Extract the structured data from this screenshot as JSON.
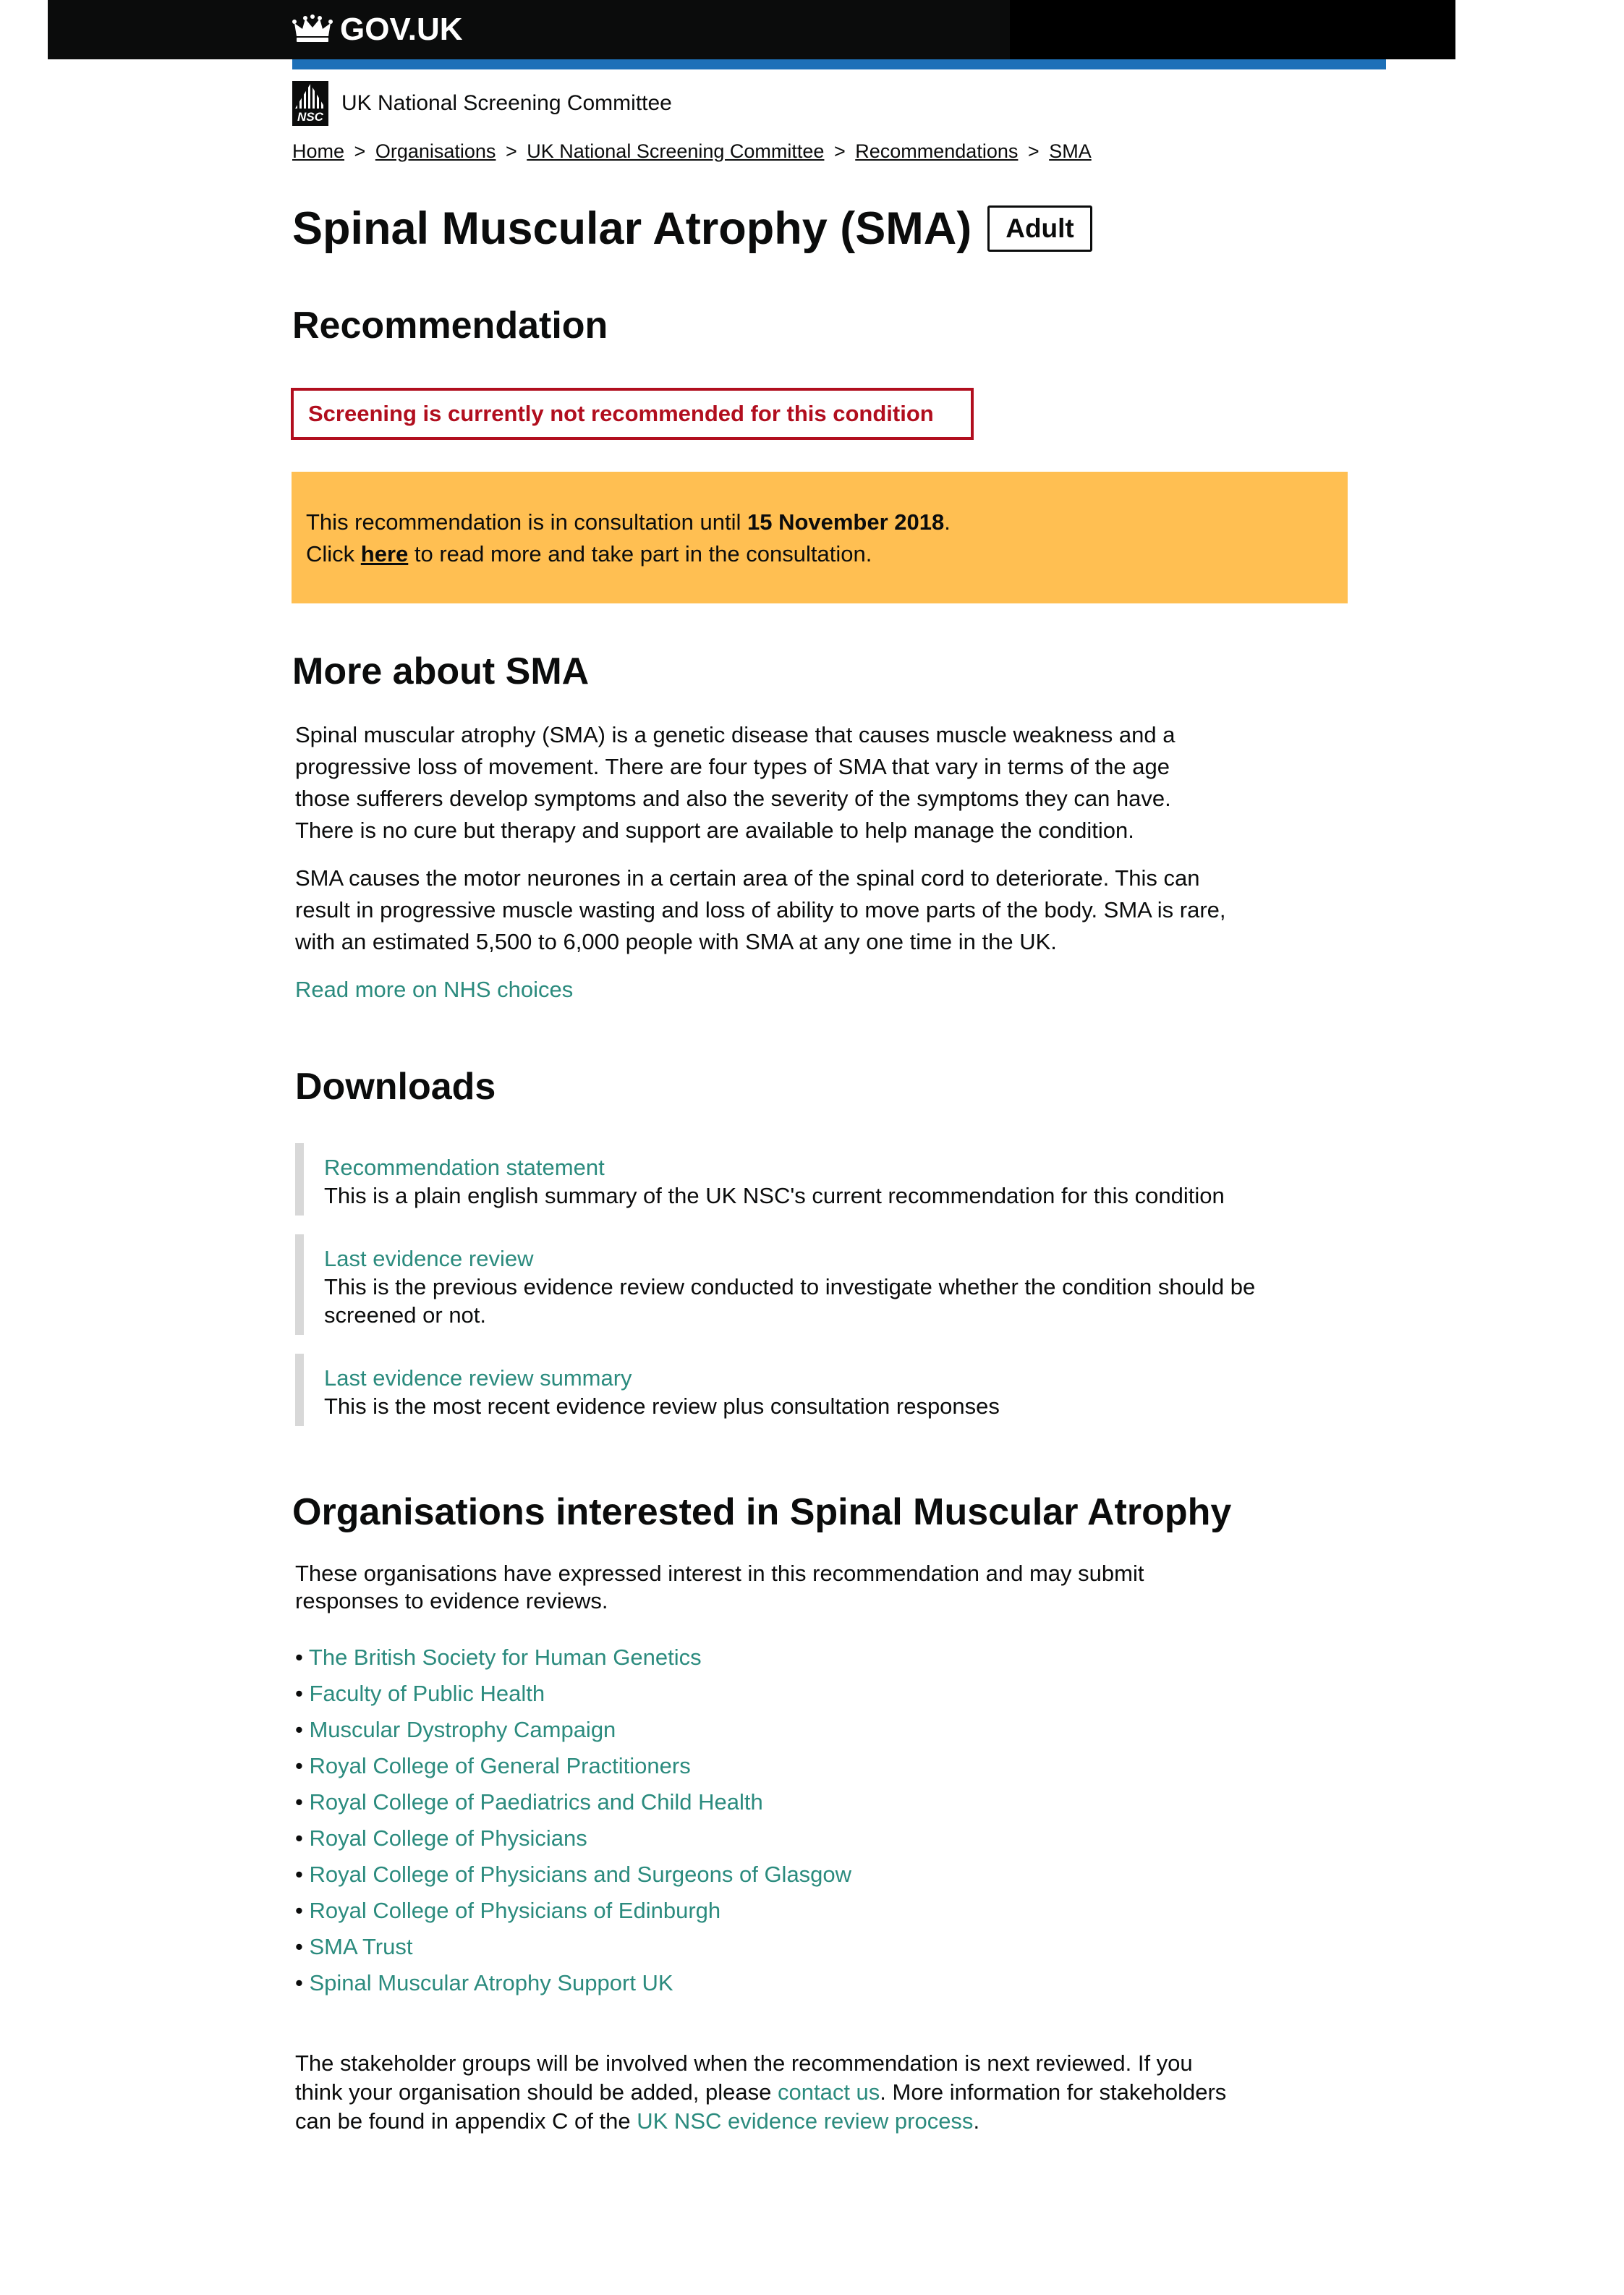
{
  "header": {
    "brand": "GOV.UK",
    "crown_icon": "crown-icon"
  },
  "org": {
    "logo_text": "NSC",
    "name": "UK National Screening Committee"
  },
  "breadcrumb": {
    "items": [
      "Home",
      "Organisations",
      "UK National Screening Committee",
      "Recommendations",
      "SMA"
    ],
    "separator": ">"
  },
  "title": "Spinal Muscular Atrophy (SMA)",
  "tag": "Adult",
  "recommendation": {
    "heading": "Recommendation",
    "status": "Screening is currently not recommended for this condition",
    "status_color": "#b10e1e"
  },
  "consultation": {
    "line1_prefix": "This recommendation is in consultation until ",
    "date": "15 November 2018",
    "line1_suffix": ".",
    "line2_prefix": "Click ",
    "link": "here",
    "line2_suffix": " to read more and take part in the consultation.",
    "background": "#ffbf52"
  },
  "more": {
    "heading": "More about SMA",
    "para1": "Spinal muscular atrophy (SMA) is a genetic disease that causes muscle weakness and a progressive loss of movement. There are four types of SMA that vary in terms of the age those sufferers develop symptoms and also the severity of the symptoms they can have. There is no cure but therapy and support are available to help manage the condition.",
    "para2": "SMA causes the motor neurones in a certain area of the spinal cord to deteriorate. This can result in progressive muscle wasting and loss of ability to move parts of the body. SMA is rare, with an estimated 5,500 to 6,000 people with SMA at any one time in the UK.",
    "link": "Read more on NHS choices"
  },
  "downloads": {
    "heading": "Downloads",
    "items": [
      {
        "title": "Recommendation statement",
        "desc": "This is a plain english summary of the UK NSC's current recommendation for this condition"
      },
      {
        "title": "Last evidence review",
        "desc": "This is the previous evidence review conducted to investigate whether the condition should be screened or not."
      },
      {
        "title": "Last evidence review summary",
        "desc": "This is the most recent evidence review plus consultation responses"
      }
    ]
  },
  "organisations": {
    "heading": "Organisations interested in Spinal Muscular Atrophy",
    "intro": "These organisations have expressed interest in this recommendation and may submit responses to evidence reviews.",
    "items": [
      "The British Society for Human Genetics",
      "Faculty of Public Health",
      "Muscular Dystrophy Campaign",
      "Royal College of General Practitioners",
      "Royal College of Paediatrics and Child Health",
      "Royal College of Physicians",
      "Royal College of Physicians and Surgeons of Glasgow",
      "Royal College of Physicians of Edinburgh",
      "SMA Trust",
      "Spinal Muscular Atrophy Support UK"
    ]
  },
  "stakeholder": {
    "text1": "The stakeholder groups will be involved when the recommendation is next reviewed. If you think your organisation should be added, please ",
    "contact_link": "contact us",
    "text2": ". More information for stakeholders can be found in appendix C of the ",
    "process_link": "UK NSC evidence review process",
    "text3": "."
  },
  "colors": {
    "link_green": "#2b8b7e",
    "header_blue": "#1d70b8"
  }
}
